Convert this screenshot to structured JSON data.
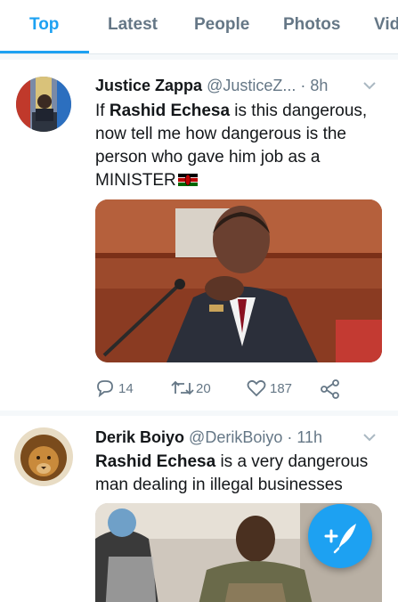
{
  "tabs": [
    {
      "label": "Top",
      "active": true
    },
    {
      "label": "Latest",
      "active": false
    },
    {
      "label": "People",
      "active": false
    },
    {
      "label": "Photos",
      "active": false
    },
    {
      "label": "Vid",
      "active": false
    }
  ],
  "tweets": [
    {
      "name": "Justice Zappa",
      "handle": "@JusticeZ...",
      "time": "· 8h",
      "text_bold_1": "Rashid Echesa",
      "text_pre": "If ",
      "text_post": " is this dangerous, now tell me how dangerous is the person who gave him job as a MINISTER",
      "flag_icon": "kenya-flag-emoji",
      "replies": "14",
      "retweets": "20",
      "likes": "187"
    },
    {
      "name": "Derik Boiyo",
      "handle": "@DerikBoiyo",
      "time": "· 11h",
      "text_bold_1": "Rashid Echesa",
      "text_post": " is a very dangerous man dealing in illegal businesses"
    }
  ],
  "colors": {
    "accent": "#1da1f2",
    "muted": "#657786",
    "divider": "#f5f8fa"
  },
  "fab": {
    "icon": "compose-tweet-icon"
  }
}
